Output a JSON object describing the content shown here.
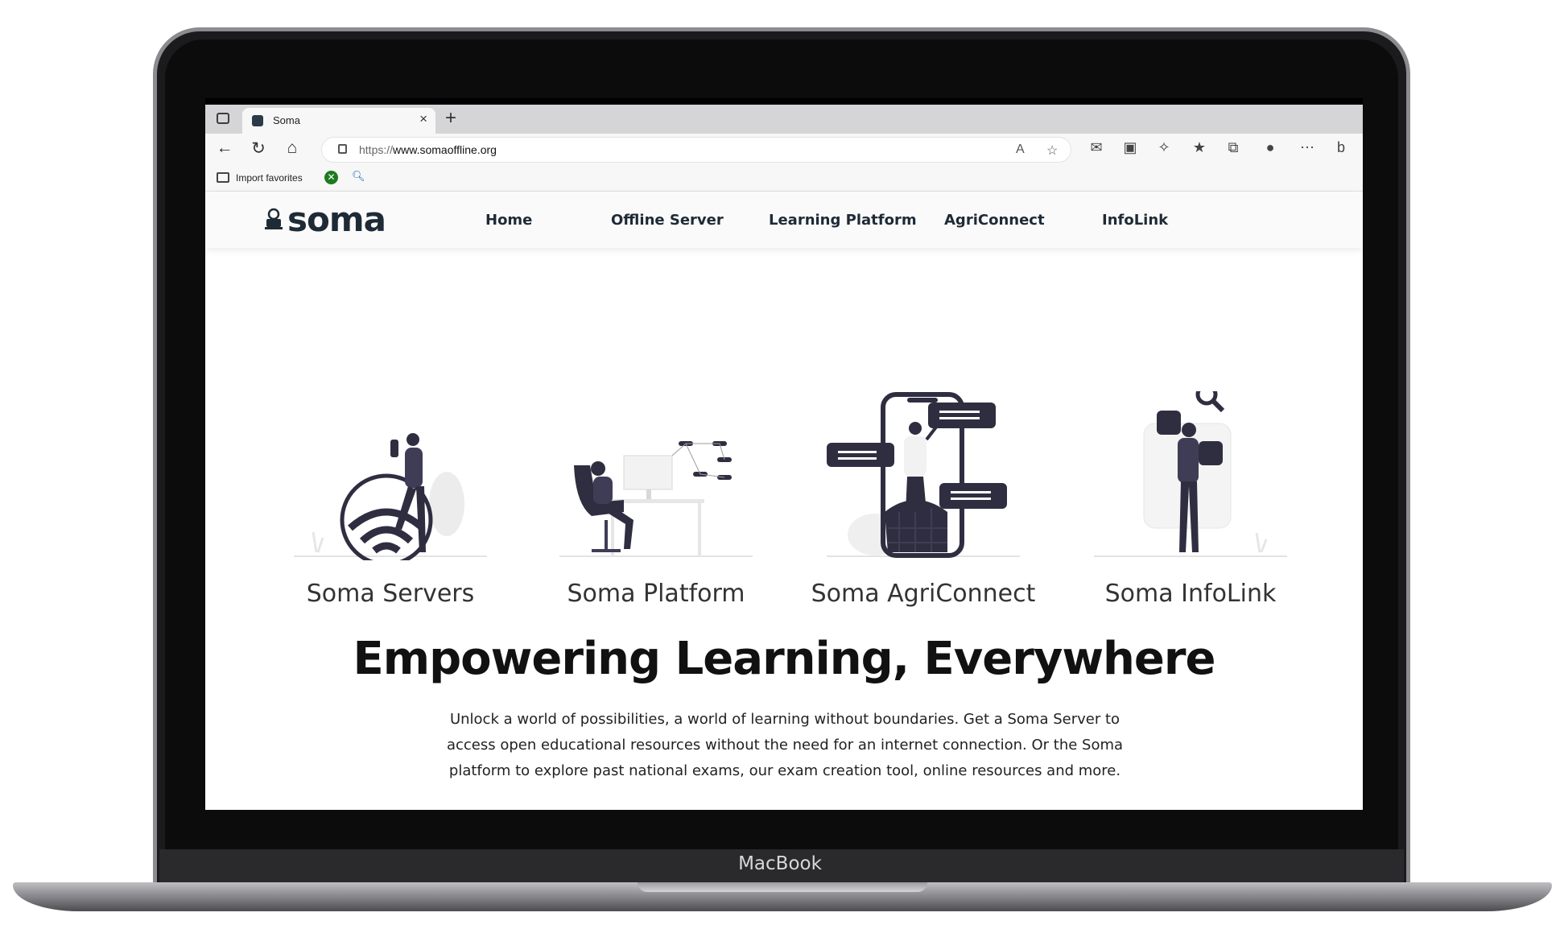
{
  "device": {
    "brand": "MacBook"
  },
  "browser": {
    "tab": {
      "title": "Soma"
    },
    "address": {
      "scheme": "https://",
      "host": "www.somaoffline.org"
    },
    "favorites": {
      "import_label": "Import favorites"
    }
  },
  "site": {
    "logo": "soma",
    "nav": [
      {
        "label": "Home"
      },
      {
        "label": "Offline Server"
      },
      {
        "label": "Learning Platform"
      },
      {
        "label": "AgriConnect"
      },
      {
        "label": "InfoLink"
      }
    ],
    "cards": [
      {
        "title": "Soma Servers"
      },
      {
        "title": "Soma Platform"
      },
      {
        "title": "Soma AgriConnect"
      },
      {
        "title": "Soma InfoLink"
      }
    ],
    "hero": {
      "title": "Empowering Learning, Everywhere",
      "text": "Unlock a world of possibilities, a world of learning without boundaries. Get a Soma Server to access open educational resources without the need for an internet connection. Or the Soma platform to explore past national exams, our exam creation tool, online resources and more."
    }
  },
  "colors": {
    "dark": "#2f2e41",
    "navy": "#1e2b36",
    "light": "#e6e6e6"
  }
}
